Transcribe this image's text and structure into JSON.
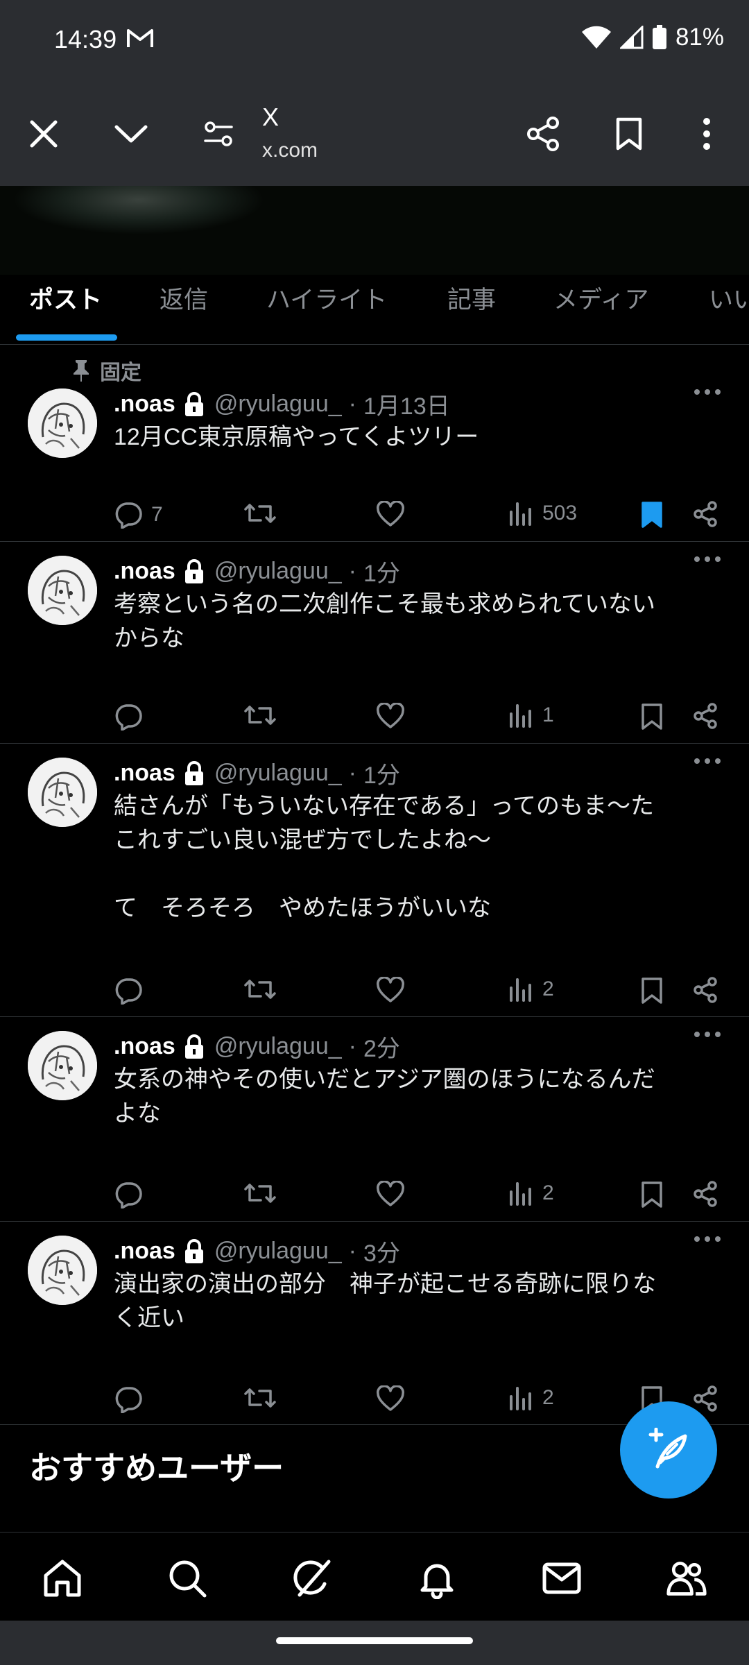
{
  "status_bar": {
    "time": "14:39",
    "battery": "81%"
  },
  "browser": {
    "title": "X",
    "url": "x.com"
  },
  "tabs": [
    "ポスト",
    "返信",
    "ハイライト",
    "記事",
    "メディア",
    "いい"
  ],
  "pinned_label": "固定",
  "posts": [
    {
      "name": ".noas",
      "handle": "@ryulaguu_",
      "time": "1月13日",
      "text": "12月CC東京原稿やってくよツリー",
      "replies": "7",
      "views": "503",
      "bookmarked": true
    },
    {
      "name": ".noas",
      "handle": "@ryulaguu_",
      "time": "1分",
      "text": "考察という名の二次創作こそ最も求められていない\nからな",
      "replies": "",
      "views": "1",
      "bookmarked": false
    },
    {
      "name": ".noas",
      "handle": "@ryulaguu_",
      "time": "1分",
      "text": "結さんが「もういない存在である」ってのもま〜た\nこれすごい良い混ぜ方でしたよね〜\n\nて　そろそろ　やめたほうがいいな",
      "replies": "",
      "views": "2",
      "bookmarked": false
    },
    {
      "name": ".noas",
      "handle": "@ryulaguu_",
      "time": "2分",
      "text": "女系の神やその使いだとアジア圏のほうになるんだ\nよな",
      "replies": "",
      "views": "2",
      "bookmarked": false
    },
    {
      "name": ".noas",
      "handle": "@ryulaguu_",
      "time": "3分",
      "text": "演出家の演出の部分　神子が起こせる奇跡に限りな\nく近い",
      "replies": "",
      "views": "2",
      "bookmarked": false
    }
  ],
  "section_title": "おすすめユーザー",
  "colors": {
    "accent": "#1d9bf0",
    "background": "#000000",
    "chrome": "#2b2d31"
  }
}
